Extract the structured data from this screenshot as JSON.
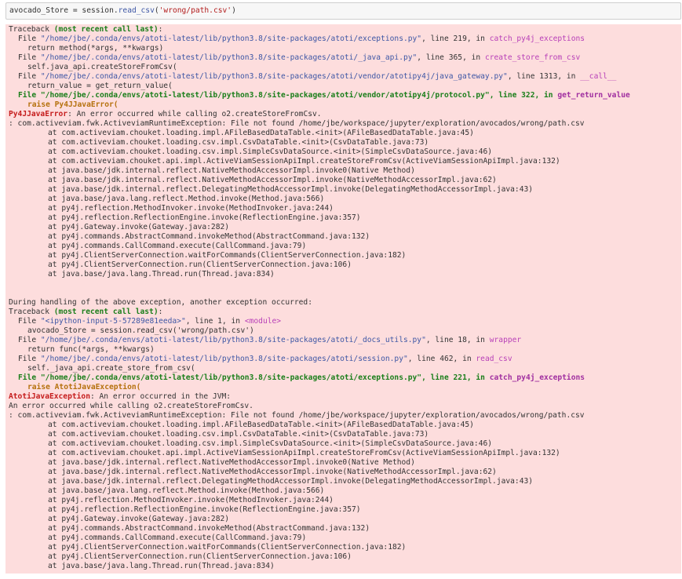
{
  "input_cell": {
    "var": "avocado_Store",
    "op": " = ",
    "obj": "session.",
    "method": "read_csv",
    "open": "(",
    "arg": "'wrong/path.csv'",
    "close": ")"
  },
  "traceback1": {
    "header_prefix": "Traceback ",
    "header_bold": "(most recent call last)",
    "header_suffix": ":",
    "frames": [
      {
        "path": "\"/home/jbe/.conda/envs/atoti-latest/lib/python3.8/site-packages/atoti/exceptions.py\"",
        "line": "219",
        "func": "catch_py4j_exceptions",
        "code": "return method(*args, **kwargs)"
      },
      {
        "path": "\"/home/jbe/.conda/envs/atoti-latest/lib/python3.8/site-packages/atoti/_java_api.py\"",
        "line": "365",
        "func": "create_store_from_csv",
        "code": "self.java_api.createStoreFromCsv("
      },
      {
        "path": "\"/home/jbe/.conda/envs/atoti-latest/lib/python3.8/site-packages/atoti/vendor/atotipy4j/java_gateway.py\"",
        "line": "1313",
        "func": "__call__",
        "code": "return_value = get_return_value("
      }
    ],
    "last_frame": {
      "path": "\"/home/jbe/.conda/envs/atoti-latest/lib/python3.8/site-packages/atoti/vendor/atotipy4j/protocol.py\"",
      "line": "322",
      "func": "get_return_value",
      "code": "raise Py4JJavaError("
    },
    "error_name": "Py4JJavaError",
    "error_msg": ": An error occurred while calling o2.createStoreFromCsv.",
    "exception_line": ": com.activeviam.fwk.ActiveviamRuntimeException: File not found /home/jbe/workspace/jupyter/exploration/avocados/wrong/path.csv",
    "stack": [
      "at com.activeviam.chouket.loading.impl.AFileBasedDataTable.<init>(AFileBasedDataTable.java:45)",
      "at com.activeviam.chouket.loading.csv.impl.CsvDataTable.<init>(CsvDataTable.java:73)",
      "at com.activeviam.chouket.loading.csv.impl.SimpleCsvDataSource.<init>(SimpleCsvDataSource.java:46)",
      "at com.activeviam.chouket.api.impl.ActiveViamSessionApiImpl.createStoreFromCsv(ActiveViamSessionApiImpl.java:132)",
      "at java.base/jdk.internal.reflect.NativeMethodAccessorImpl.invoke0(Native Method)",
      "at java.base/jdk.internal.reflect.NativeMethodAccessorImpl.invoke(NativeMethodAccessorImpl.java:62)",
      "at java.base/jdk.internal.reflect.DelegatingMethodAccessorImpl.invoke(DelegatingMethodAccessorImpl.java:43)",
      "at java.base/java.lang.reflect.Method.invoke(Method.java:566)",
      "at py4j.reflection.MethodInvoker.invoke(MethodInvoker.java:244)",
      "at py4j.reflection.ReflectionEngine.invoke(ReflectionEngine.java:357)",
      "at py4j.Gateway.invoke(Gateway.java:282)",
      "at py4j.commands.AbstractCommand.invokeMethod(AbstractCommand.java:132)",
      "at py4j.commands.CallCommand.execute(CallCommand.java:79)",
      "at py4j.ClientServerConnection.waitForCommands(ClientServerConnection.java:182)",
      "at py4j.ClientServerConnection.run(ClientServerConnection.java:106)",
      "at java.base/java.lang.Thread.run(Thread.java:834)"
    ]
  },
  "during_handling": "During handling of the above exception, another exception occurred:",
  "traceback2": {
    "header_prefix": "Traceback ",
    "header_bold": "(most recent call last)",
    "header_suffix": ":",
    "frames": [
      {
        "path": "\"<ipython-input-5-57289e81eeda>\"",
        "line": "1",
        "func": "<module>",
        "code": "avocado_Store = session.read_csv('wrong/path.csv')"
      },
      {
        "path": "\"/home/jbe/.conda/envs/atoti-latest/lib/python3.8/site-packages/atoti/_docs_utils.py\"",
        "line": "18",
        "func": "wrapper",
        "code": "return func(*args, **kwargs)"
      },
      {
        "path": "\"/home/jbe/.conda/envs/atoti-latest/lib/python3.8/site-packages/atoti/session.py\"",
        "line": "462",
        "func": "read_csv",
        "code": "self._java_api.create_store_from_csv("
      }
    ],
    "last_frame": {
      "path": "\"/home/jbe/.conda/envs/atoti-latest/lib/python3.8/site-packages/atoti/exceptions.py\"",
      "line": "221",
      "func": "catch_py4j_exceptions",
      "code": "raise AtotiJavaException("
    },
    "error_name": "AtotiJavaException",
    "error_msg": ": An error occurred in the JVM:",
    "error_msg2": "An error occurred while calling o2.createStoreFromCsv.",
    "exception_line": ": com.activeviam.fwk.ActiveviamRuntimeException: File not found /home/jbe/workspace/jupyter/exploration/avocados/wrong/path.csv",
    "stack": [
      "at com.activeviam.chouket.loading.impl.AFileBasedDataTable.<init>(AFileBasedDataTable.java:45)",
      "at com.activeviam.chouket.loading.csv.impl.CsvDataTable.<init>(CsvDataTable.java:73)",
      "at com.activeviam.chouket.loading.csv.impl.SimpleCsvDataSource.<init>(SimpleCsvDataSource.java:46)",
      "at com.activeviam.chouket.api.impl.ActiveViamSessionApiImpl.createStoreFromCsv(ActiveViamSessionApiImpl.java:132)",
      "at java.base/jdk.internal.reflect.NativeMethodAccessorImpl.invoke0(Native Method)",
      "at java.base/jdk.internal.reflect.NativeMethodAccessorImpl.invoke(NativeMethodAccessorImpl.java:62)",
      "at java.base/jdk.internal.reflect.DelegatingMethodAccessorImpl.invoke(DelegatingMethodAccessorImpl.java:43)",
      "at java.base/java.lang.reflect.Method.invoke(Method.java:566)",
      "at py4j.reflection.MethodInvoker.invoke(MethodInvoker.java:244)",
      "at py4j.reflection.ReflectionEngine.invoke(ReflectionEngine.java:357)",
      "at py4j.Gateway.invoke(Gateway.java:282)",
      "at py4j.commands.AbstractCommand.invokeMethod(AbstractCommand.java:132)",
      "at py4j.commands.CallCommand.execute(CallCommand.java:79)",
      "at py4j.ClientServerConnection.waitForCommands(ClientServerConnection.java:182)",
      "at py4j.ClientServerConnection.run(ClientServerConnection.java:106)",
      "at java.base/java.lang.Thread.run(Thread.java:834)"
    ]
  },
  "labels": {
    "file_kw": "File ",
    "line_sep": ", line ",
    "in_sep": ", in "
  },
  "colors": {
    "error_background": "#fddddd",
    "input_background": "#f7f7f7"
  }
}
